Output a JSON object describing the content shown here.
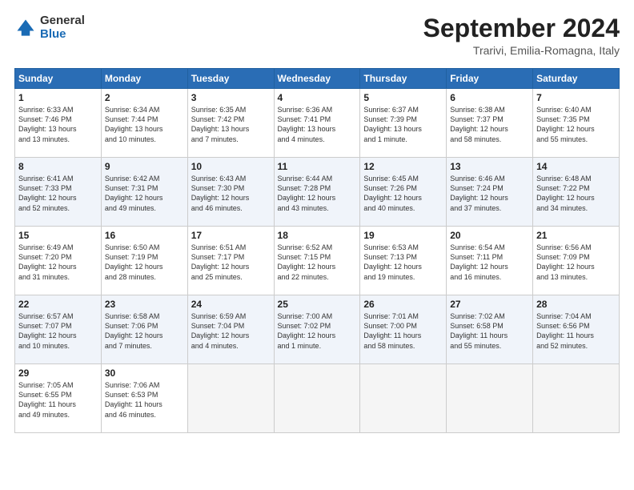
{
  "header": {
    "logo_general": "General",
    "logo_blue": "Blue",
    "month_title": "September 2024",
    "location": "Trarivi, Emilia-Romagna, Italy"
  },
  "weekdays": [
    "Sunday",
    "Monday",
    "Tuesday",
    "Wednesday",
    "Thursday",
    "Friday",
    "Saturday"
  ],
  "weeks": [
    [
      {
        "day": 1,
        "info": "Sunrise: 6:33 AM\nSunset: 7:46 PM\nDaylight: 13 hours\nand 13 minutes."
      },
      {
        "day": 2,
        "info": "Sunrise: 6:34 AM\nSunset: 7:44 PM\nDaylight: 13 hours\nand 10 minutes."
      },
      {
        "day": 3,
        "info": "Sunrise: 6:35 AM\nSunset: 7:42 PM\nDaylight: 13 hours\nand 7 minutes."
      },
      {
        "day": 4,
        "info": "Sunrise: 6:36 AM\nSunset: 7:41 PM\nDaylight: 13 hours\nand 4 minutes."
      },
      {
        "day": 5,
        "info": "Sunrise: 6:37 AM\nSunset: 7:39 PM\nDaylight: 13 hours\nand 1 minute."
      },
      {
        "day": 6,
        "info": "Sunrise: 6:38 AM\nSunset: 7:37 PM\nDaylight: 12 hours\nand 58 minutes."
      },
      {
        "day": 7,
        "info": "Sunrise: 6:40 AM\nSunset: 7:35 PM\nDaylight: 12 hours\nand 55 minutes."
      }
    ],
    [
      {
        "day": 8,
        "info": "Sunrise: 6:41 AM\nSunset: 7:33 PM\nDaylight: 12 hours\nand 52 minutes."
      },
      {
        "day": 9,
        "info": "Sunrise: 6:42 AM\nSunset: 7:31 PM\nDaylight: 12 hours\nand 49 minutes."
      },
      {
        "day": 10,
        "info": "Sunrise: 6:43 AM\nSunset: 7:30 PM\nDaylight: 12 hours\nand 46 minutes."
      },
      {
        "day": 11,
        "info": "Sunrise: 6:44 AM\nSunset: 7:28 PM\nDaylight: 12 hours\nand 43 minutes."
      },
      {
        "day": 12,
        "info": "Sunrise: 6:45 AM\nSunset: 7:26 PM\nDaylight: 12 hours\nand 40 minutes."
      },
      {
        "day": 13,
        "info": "Sunrise: 6:46 AM\nSunset: 7:24 PM\nDaylight: 12 hours\nand 37 minutes."
      },
      {
        "day": 14,
        "info": "Sunrise: 6:48 AM\nSunset: 7:22 PM\nDaylight: 12 hours\nand 34 minutes."
      }
    ],
    [
      {
        "day": 15,
        "info": "Sunrise: 6:49 AM\nSunset: 7:20 PM\nDaylight: 12 hours\nand 31 minutes."
      },
      {
        "day": 16,
        "info": "Sunrise: 6:50 AM\nSunset: 7:19 PM\nDaylight: 12 hours\nand 28 minutes."
      },
      {
        "day": 17,
        "info": "Sunrise: 6:51 AM\nSunset: 7:17 PM\nDaylight: 12 hours\nand 25 minutes."
      },
      {
        "day": 18,
        "info": "Sunrise: 6:52 AM\nSunset: 7:15 PM\nDaylight: 12 hours\nand 22 minutes."
      },
      {
        "day": 19,
        "info": "Sunrise: 6:53 AM\nSunset: 7:13 PM\nDaylight: 12 hours\nand 19 minutes."
      },
      {
        "day": 20,
        "info": "Sunrise: 6:54 AM\nSunset: 7:11 PM\nDaylight: 12 hours\nand 16 minutes."
      },
      {
        "day": 21,
        "info": "Sunrise: 6:56 AM\nSunset: 7:09 PM\nDaylight: 12 hours\nand 13 minutes."
      }
    ],
    [
      {
        "day": 22,
        "info": "Sunrise: 6:57 AM\nSunset: 7:07 PM\nDaylight: 12 hours\nand 10 minutes."
      },
      {
        "day": 23,
        "info": "Sunrise: 6:58 AM\nSunset: 7:06 PM\nDaylight: 12 hours\nand 7 minutes."
      },
      {
        "day": 24,
        "info": "Sunrise: 6:59 AM\nSunset: 7:04 PM\nDaylight: 12 hours\nand 4 minutes."
      },
      {
        "day": 25,
        "info": "Sunrise: 7:00 AM\nSunset: 7:02 PM\nDaylight: 12 hours\nand 1 minute."
      },
      {
        "day": 26,
        "info": "Sunrise: 7:01 AM\nSunset: 7:00 PM\nDaylight: 11 hours\nand 58 minutes."
      },
      {
        "day": 27,
        "info": "Sunrise: 7:02 AM\nSunset: 6:58 PM\nDaylight: 11 hours\nand 55 minutes."
      },
      {
        "day": 28,
        "info": "Sunrise: 7:04 AM\nSunset: 6:56 PM\nDaylight: 11 hours\nand 52 minutes."
      }
    ],
    [
      {
        "day": 29,
        "info": "Sunrise: 7:05 AM\nSunset: 6:55 PM\nDaylight: 11 hours\nand 49 minutes."
      },
      {
        "day": 30,
        "info": "Sunrise: 7:06 AM\nSunset: 6:53 PM\nDaylight: 11 hours\nand 46 minutes."
      },
      null,
      null,
      null,
      null,
      null
    ]
  ]
}
